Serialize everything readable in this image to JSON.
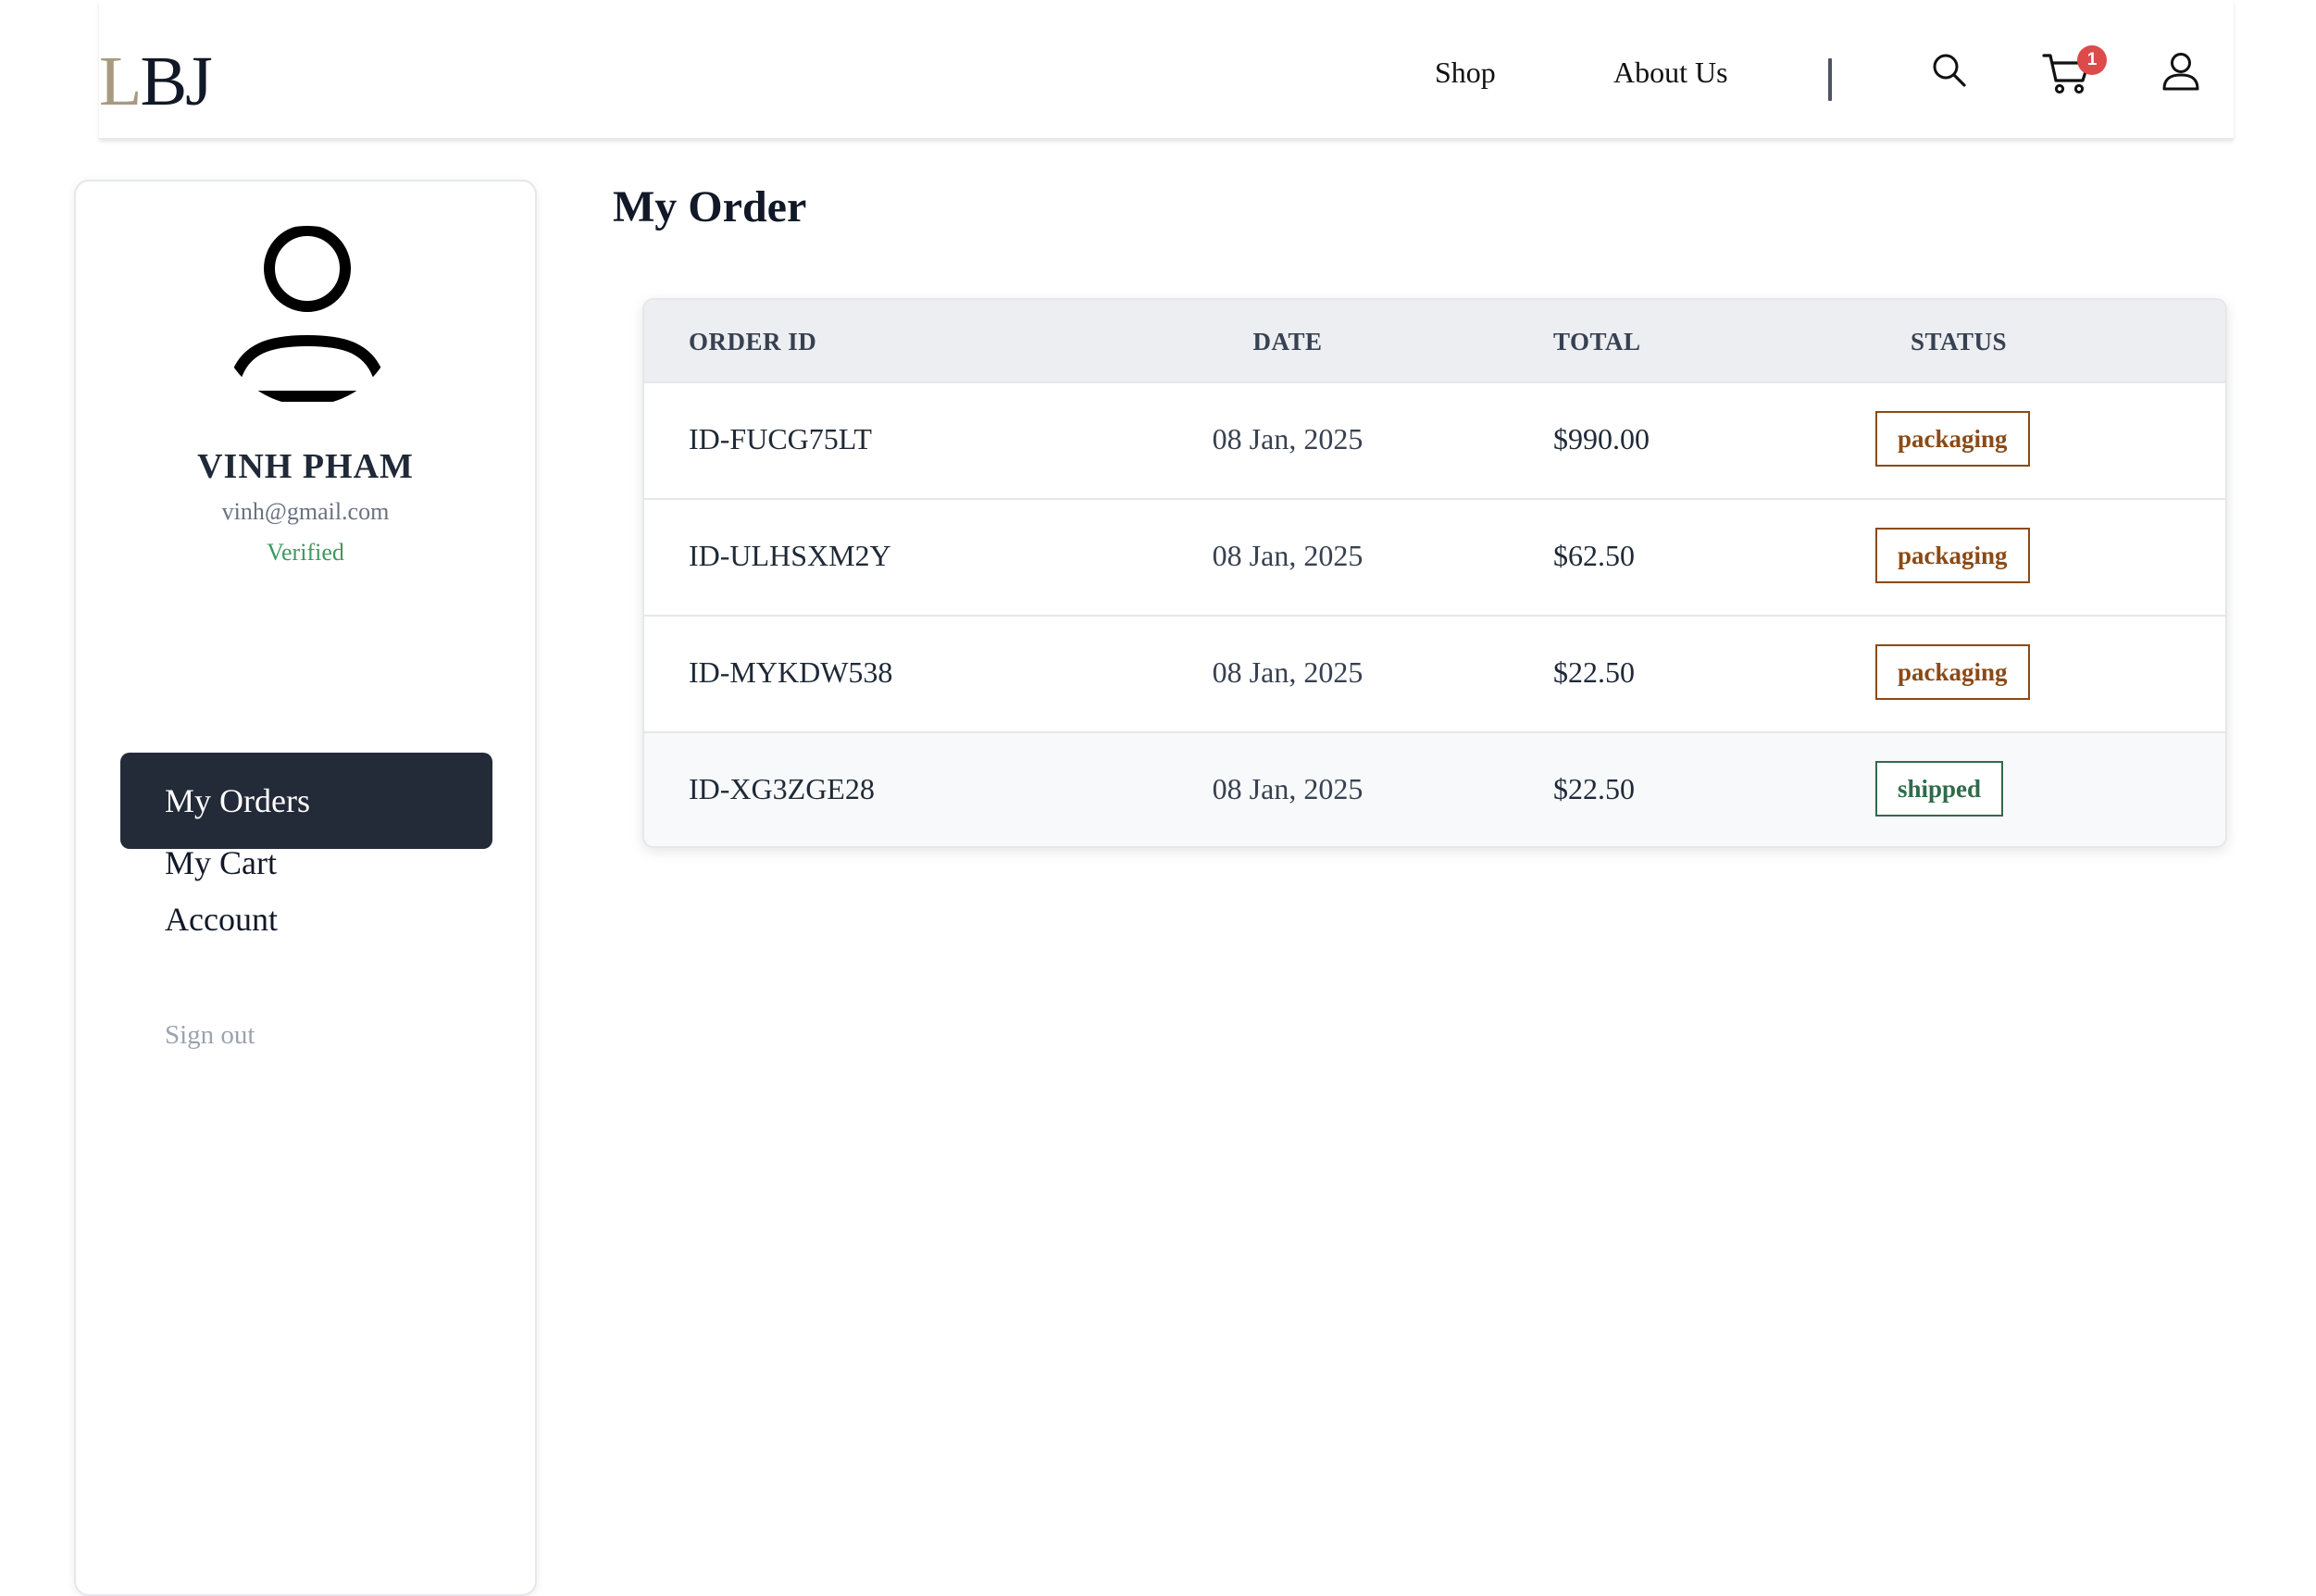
{
  "header": {
    "logo_l": "L",
    "logo_bj": "BJ",
    "nav_shop": "Shop",
    "nav_about": "About Us",
    "cart_count": "1",
    "icons": [
      "search-icon",
      "cart-icon",
      "user-icon"
    ]
  },
  "profile": {
    "name": "VINH PHAM",
    "email": "vinh@gmail.com",
    "status": "Verified"
  },
  "menu": {
    "cart": "My Cart",
    "orders": "My Orders",
    "account": "Account",
    "signout": "Sign out"
  },
  "main": {
    "title": "My Order",
    "columns": {
      "id": "ORDER ID",
      "date": "DATE",
      "total": "TOTAL",
      "status": "STATUS"
    },
    "orders": [
      {
        "id": "ID-FUCG75LT",
        "date": "08 Jan, 2025",
        "total": "$990.00",
        "status": "packaging"
      },
      {
        "id": "ID-ULHSXM2Y",
        "date": "08 Jan, 2025",
        "total": "$62.50",
        "status": "packaging"
      },
      {
        "id": "ID-MYKDW538",
        "date": "08 Jan, 2025",
        "total": "$22.50",
        "status": "packaging"
      },
      {
        "id": "ID-XG3ZGE28",
        "date": "08 Jan, 2025",
        "total": "$22.50",
        "status": "shipped"
      }
    ]
  },
  "colors": {
    "logo_accent": "#a89a80",
    "active_menu": "#232a38",
    "badge_packaging": "#8a4a16",
    "badge_shipped": "#2f6b4a",
    "verified": "#3c9a5f",
    "cart_badge": "#dc4a4a"
  }
}
